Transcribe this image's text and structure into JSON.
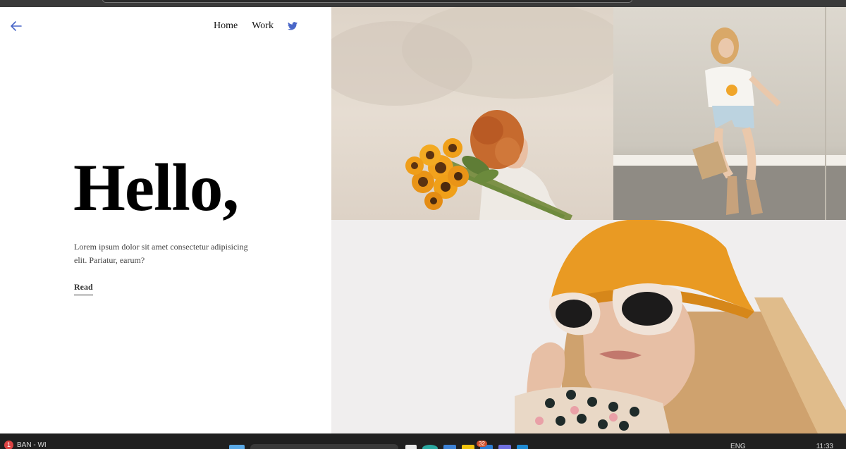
{
  "nav": {
    "back_icon": "arrow-left-icon",
    "items": [
      "Home",
      "Work"
    ],
    "social_icon": "twitter-icon",
    "accent_color": "#4a67c8"
  },
  "hero": {
    "title": "Hello,",
    "description": "Lorem ipsum dolor sit amet consectetur adipisicing elit. Pariatur, earum?",
    "cta": "Read"
  },
  "gallery": {
    "photos": [
      {
        "subject": "woman with sunflowers"
      },
      {
        "subject": "woman leaning on wall"
      },
      {
        "subject": "woman in orange bucket hat and sunglasses"
      }
    ]
  },
  "taskbar": {
    "notification_count": "1",
    "left_label": "BAN - WI",
    "badge_count": "32",
    "language": "ENG",
    "time": "11:33"
  }
}
